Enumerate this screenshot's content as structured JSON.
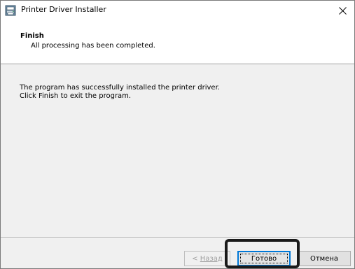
{
  "window": {
    "title": "Printer Driver Installer",
    "icon": "printer-installer-icon",
    "close_icon": "close-icon"
  },
  "header": {
    "title": "Finish",
    "subtitle": "All processing has been completed."
  },
  "content": {
    "lines": [
      "The program has successfully installed the printer driver.",
      "Click Finish to exit the program."
    ]
  },
  "buttons": {
    "back": {
      "prefix": "< ",
      "label": "Назад",
      "enabled": false
    },
    "finish": {
      "label": "Готово",
      "focused": true
    },
    "cancel": {
      "label": "Отмена"
    }
  },
  "annotation": {
    "highlight_target": "finish-button",
    "highlight_color": "#1a1a1a"
  },
  "colors": {
    "header_bg": "#ffffff",
    "body_bg": "#f0f0f0",
    "focus_accent": "#0078d7",
    "disabled_text": "#a0a0a0"
  }
}
